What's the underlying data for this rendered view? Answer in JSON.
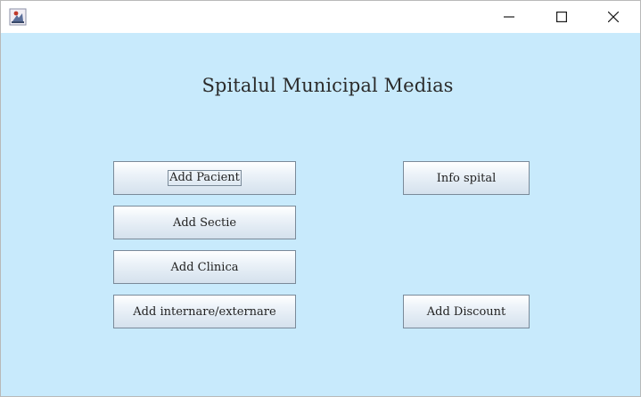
{
  "window": {
    "app_icon": "java-app-icon",
    "controls": {
      "minimize_icon": "minimize-icon",
      "maximize_icon": "maximize-icon",
      "close_icon": "close-icon"
    }
  },
  "main": {
    "title": "Spitalul Municipal Medias",
    "buttons": {
      "add_pacient": "Add Pacient",
      "add_sectie": "Add Sectie",
      "add_clinica": "Add Clinica",
      "add_internare": "Add internare/externare",
      "info_spital": "Info spital",
      "add_discount": "Add Discount"
    }
  },
  "colors": {
    "background": "#c8eafc",
    "button_border": "#7a8a99",
    "text": "#222222"
  }
}
